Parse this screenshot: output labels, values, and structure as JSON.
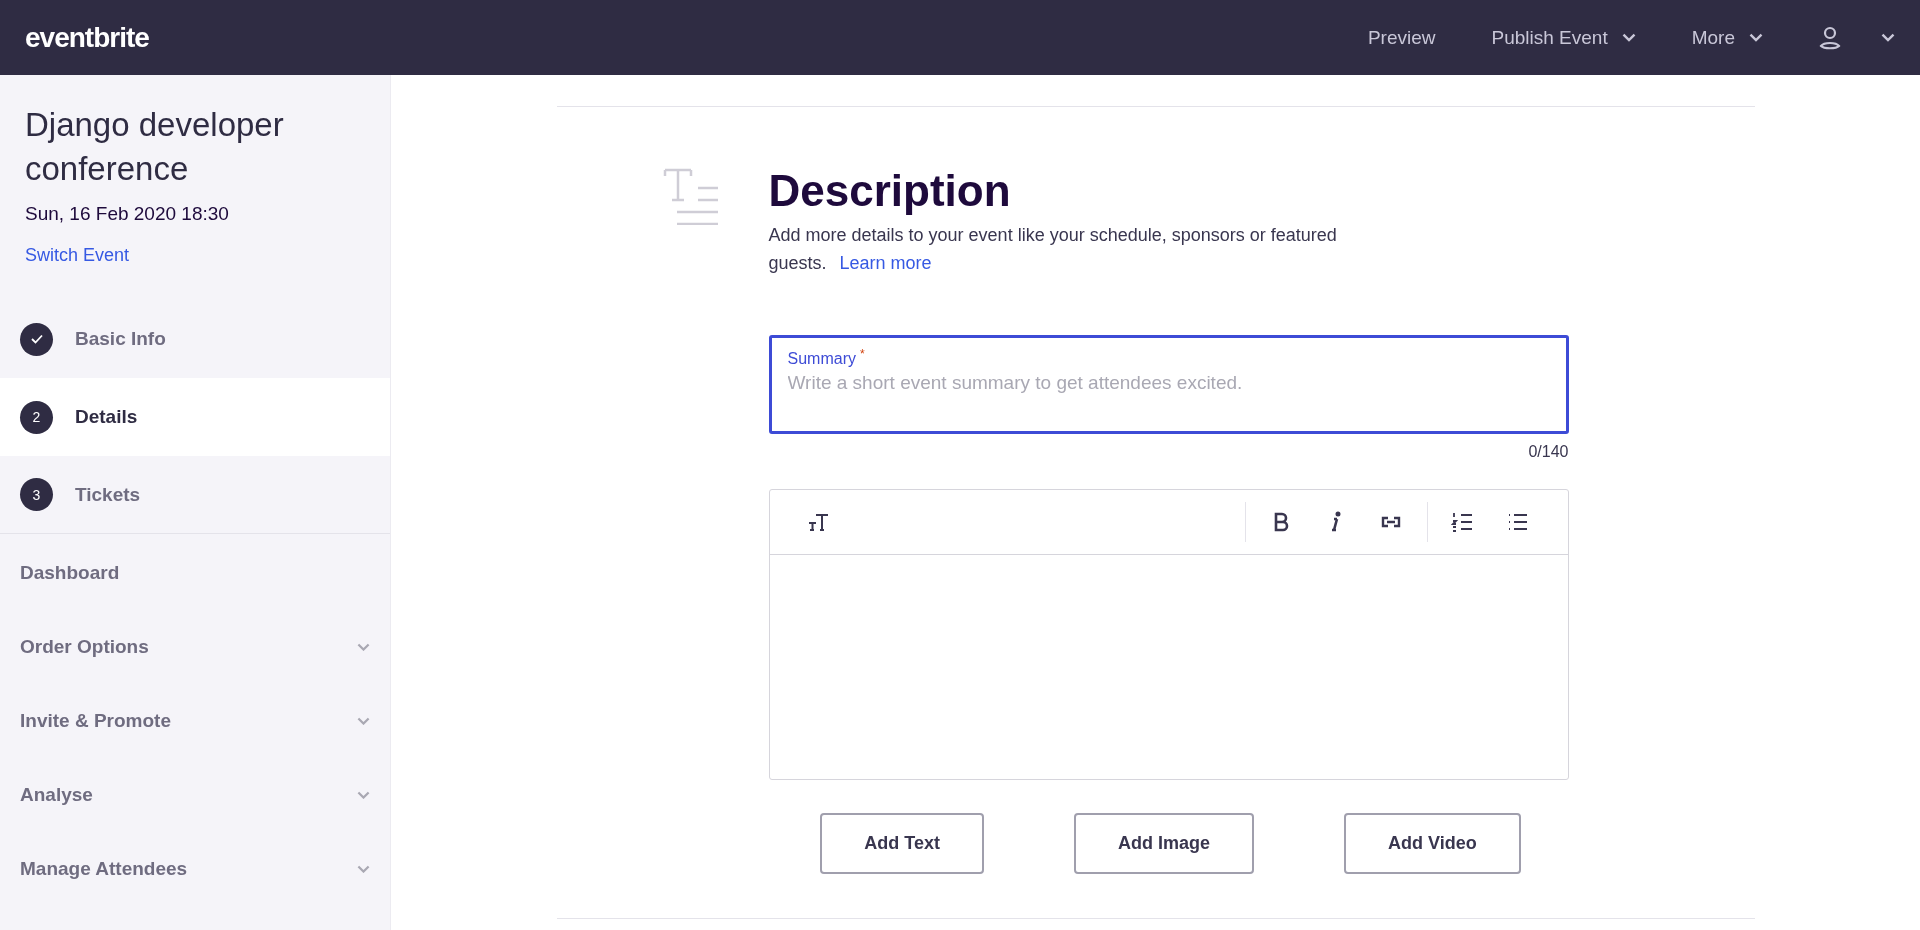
{
  "top_bar": {
    "logo": "eventbrite",
    "actions": [
      {
        "label": "Preview",
        "dropdown": false
      },
      {
        "label": "Publish Event",
        "dropdown": true
      },
      {
        "label": "More",
        "dropdown": true
      }
    ],
    "account": {
      "dropdown": true
    }
  },
  "sidebar": {
    "event_title": "Django developer conference",
    "event_date": "Sun, 16 Feb 2020 18:30",
    "switch_link": "Switch Event",
    "steps": [
      {
        "label": "Basic Info",
        "completed": true,
        "selected": false
      },
      {
        "number": "2",
        "label": "Details",
        "completed": false,
        "selected": true
      },
      {
        "number": "3",
        "label": "Tickets",
        "completed": false,
        "selected": false
      }
    ],
    "nav": [
      {
        "label": "Dashboard",
        "expandable": false
      },
      {
        "label": "Order Options",
        "expandable": true
      },
      {
        "label": "Invite & Promote",
        "expandable": true
      },
      {
        "label": "Analyse",
        "expandable": true
      },
      {
        "label": "Manage Attendees",
        "expandable": true
      }
    ]
  },
  "description": {
    "heading": "Description",
    "text": "Add more details to your event like your schedule, sponsors or featured guests.",
    "learn_more": "Learn more",
    "summary": {
      "label": "Summary",
      "required_mark": "*",
      "focused": true,
      "placeholder": "Write a short event summary to get attendees excited.",
      "counter": "0/140"
    },
    "add_buttons": [
      "Add Text",
      "Add Image",
      "Add Video"
    ]
  }
}
